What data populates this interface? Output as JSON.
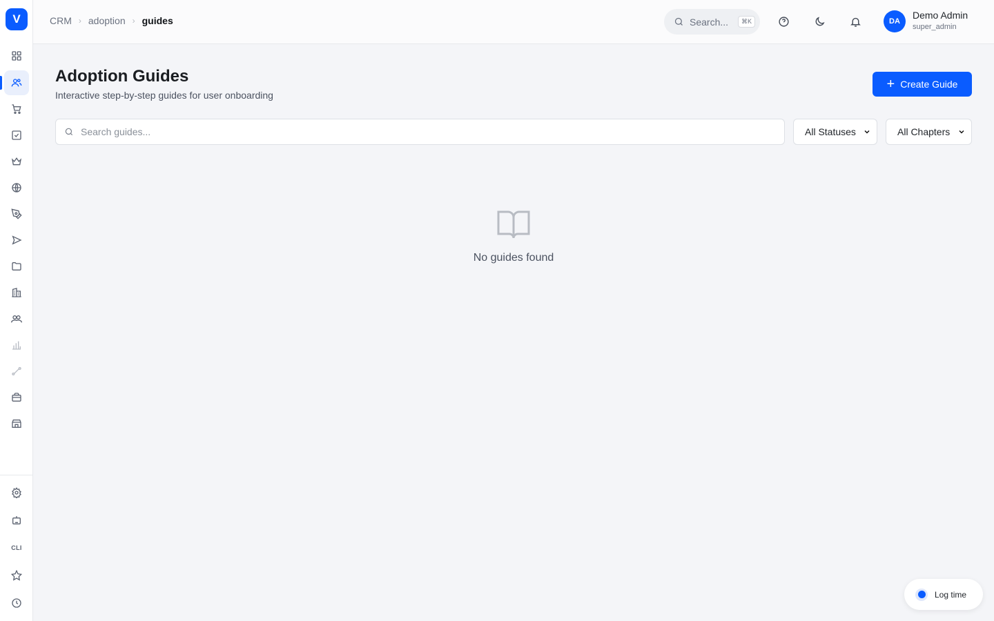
{
  "logo": {
    "letter": "V"
  },
  "breadcrumb": {
    "items": [
      "CRM",
      "adoption",
      "guides"
    ]
  },
  "top_search": {
    "label": "Search...",
    "shortcut": "⌘K"
  },
  "user": {
    "initials": "DA",
    "name": "Demo Admin",
    "role": "super_admin"
  },
  "sidebar": {
    "items": [
      {
        "icon": "grid-icon"
      },
      {
        "icon": "users-icon",
        "active": true
      },
      {
        "icon": "cart-icon"
      },
      {
        "icon": "checkbox-icon"
      },
      {
        "icon": "crown-icon"
      },
      {
        "icon": "globe-icon"
      },
      {
        "icon": "pen-tool-icon"
      },
      {
        "icon": "send-icon"
      },
      {
        "icon": "folder-icon"
      },
      {
        "icon": "building-icon"
      },
      {
        "icon": "team-icon"
      },
      {
        "icon": "bar-chart-icon"
      },
      {
        "icon": "route-icon"
      },
      {
        "icon": "briefcase-icon"
      },
      {
        "icon": "store-icon"
      }
    ],
    "bottom": [
      {
        "icon": "settings-icon"
      },
      {
        "icon": "bot-icon"
      },
      {
        "icon": "cli-icon",
        "label": "CLI"
      },
      {
        "icon": "star-icon"
      },
      {
        "icon": "clock-icon"
      }
    ]
  },
  "page": {
    "title": "Adoption Guides",
    "subtitle": "Interactive step-by-step guides for user onboarding",
    "create_button": "Create Guide"
  },
  "filters": {
    "search_placeholder": "Search guides...",
    "status_value": "All Statuses",
    "chapter_value": "All Chapters"
  },
  "empty_state": {
    "icon": "book-open-icon",
    "text": "No guides found"
  },
  "log_time": {
    "label": "Log time"
  },
  "colors": {
    "accent": "#0a5cff",
    "background": "#f4f5f8"
  }
}
